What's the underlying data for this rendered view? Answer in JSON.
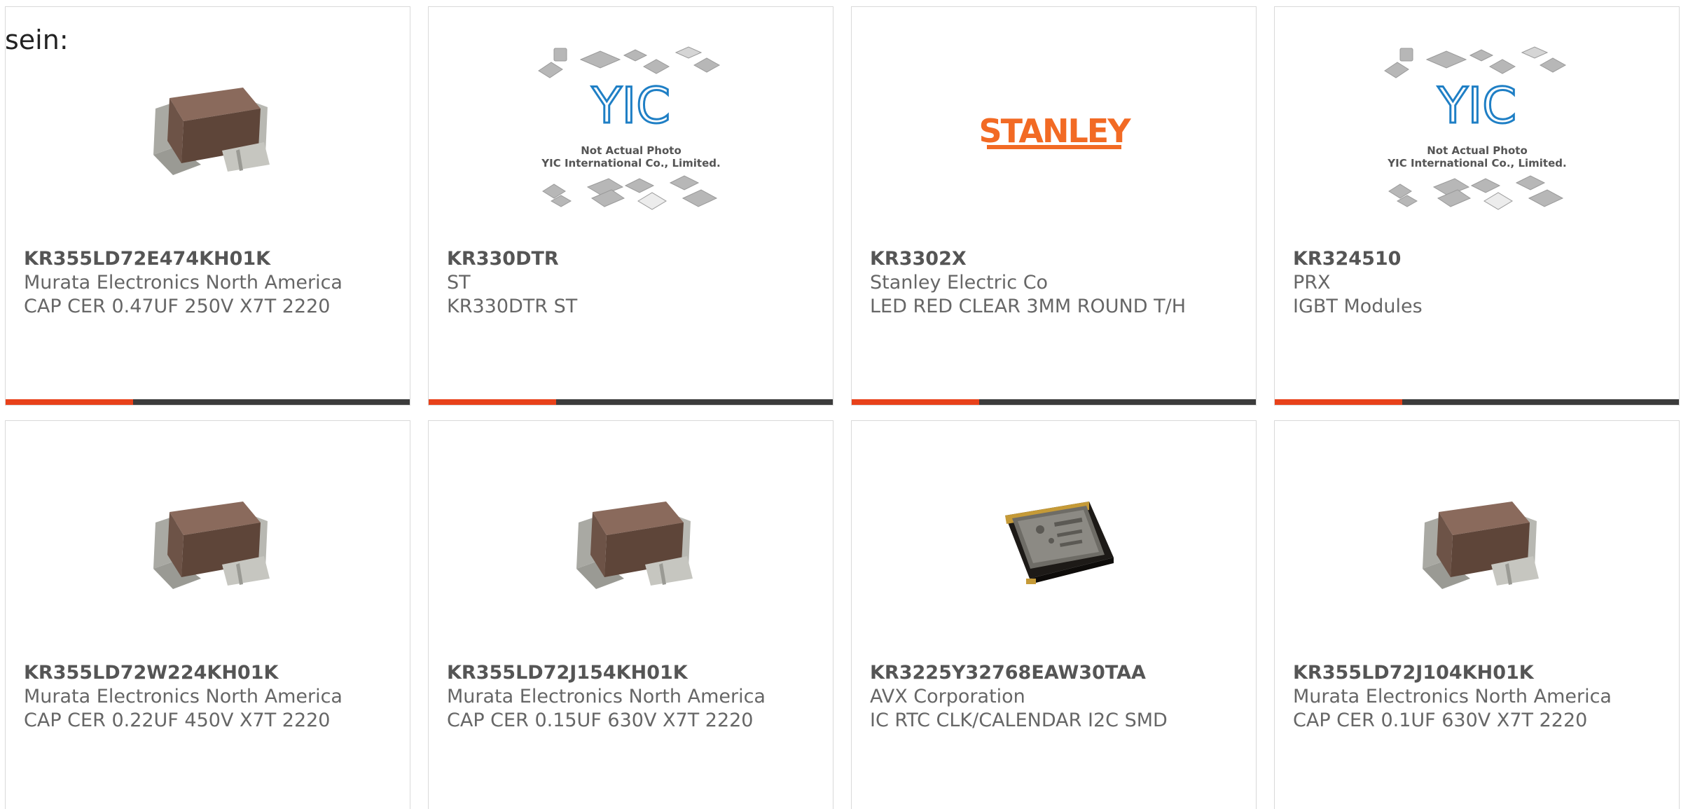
{
  "page": {
    "prefix_text": "sein:"
  },
  "colors": {
    "accent": "#e8411a",
    "bar_dark": "#3c3c3c",
    "part_number": "#555555",
    "text": "#666666",
    "stanley_logo": "#f26a24",
    "yic_logo": "#1f7fc5"
  },
  "products": [
    {
      "part_number": "KR355LD72E474KH01K",
      "manufacturer": "Murata Electronics North America",
      "description": "CAP CER 0.47UF 250V X7T 2220",
      "image": "ceramic-capacitor-image"
    },
    {
      "part_number": "KR330DTR",
      "manufacturer": "ST",
      "description": "KR330DTR ST",
      "image": "yic-placeholder-image",
      "image_caption": [
        "Not Actual Photo",
        "YIC International Co., Limited."
      ],
      "image_logo_text": "YIC"
    },
    {
      "part_number": "KR3302X",
      "manufacturer": "Stanley Electric Co",
      "description": "LED RED CLEAR 3MM ROUND T/H",
      "image": "stanley-logo-image",
      "image_logo_text": "STANLEY"
    },
    {
      "part_number": "KR324510",
      "manufacturer": "PRX",
      "description": "IGBT Modules",
      "image": "yic-placeholder-image",
      "image_caption": [
        "Not Actual Photo",
        "YIC International Co., Limited."
      ],
      "image_logo_text": "YIC"
    },
    {
      "part_number": "KR355LD72W224KH01K",
      "manufacturer": "Murata Electronics North America",
      "description": "CAP CER 0.22UF 450V X7T 2220",
      "image": "ceramic-capacitor-image"
    },
    {
      "part_number": "KR355LD72J154KH01K",
      "manufacturer": "Murata Electronics North America",
      "description": "CAP CER 0.15UF 630V X7T 2220",
      "image": "ceramic-capacitor-image"
    },
    {
      "part_number": "KR3225Y32768EAW30TAA",
      "manufacturer": "AVX Corporation",
      "description": "IC RTC CLK/CALENDAR I2C SMD",
      "image": "crystal-oscillator-image"
    },
    {
      "part_number": "KR355LD72J104KH01K",
      "manufacturer": "Murata Electronics North America",
      "description": "CAP CER 0.1UF 630V X7T 2220",
      "image": "ceramic-capacitor-image"
    }
  ]
}
